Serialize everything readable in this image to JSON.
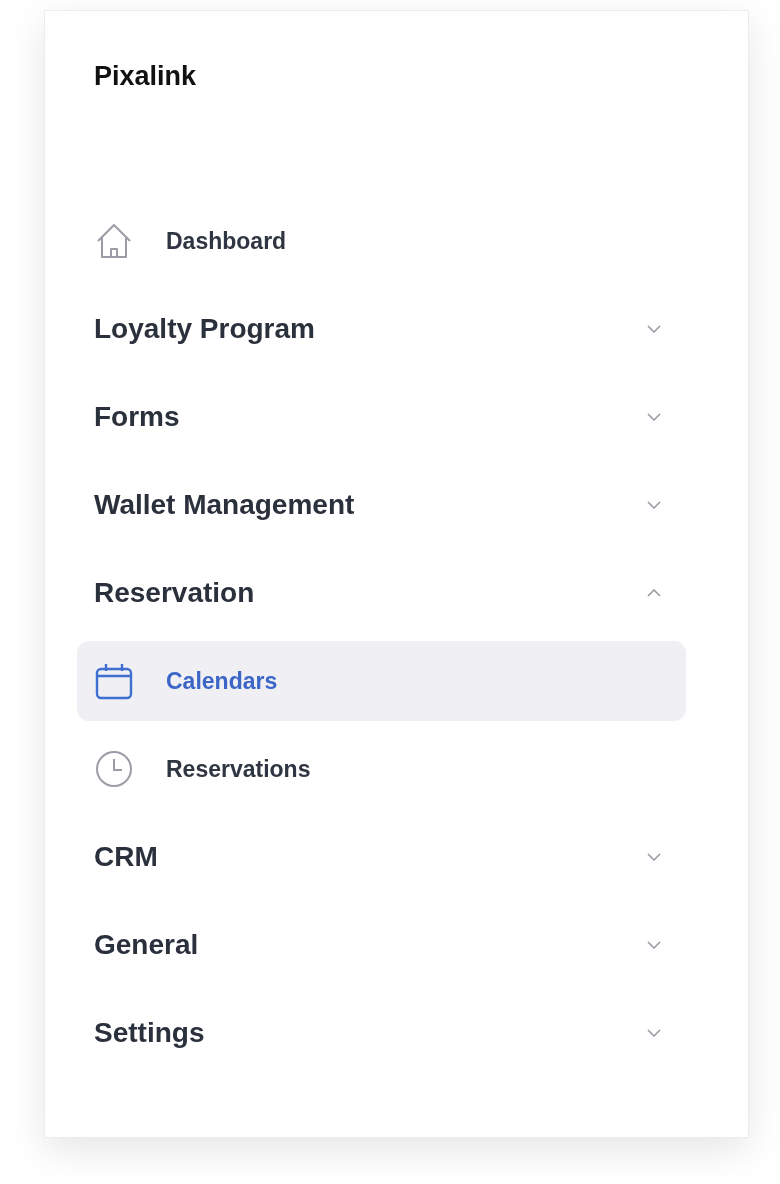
{
  "brand": "Pixalink",
  "menu": [
    {
      "kind": "link",
      "label": "Dashboard",
      "selected": false
    },
    {
      "kind": "group",
      "label": "Loyalty Program",
      "expanded": false
    },
    {
      "kind": "group",
      "label": "Forms",
      "expanded": false
    },
    {
      "kind": "group",
      "label": "Wallet Management",
      "expanded": false
    },
    {
      "kind": "group",
      "label": "Reservation",
      "expanded": true,
      "children": [
        {
          "kind": "link",
          "label": "Calendars",
          "selected": true
        },
        {
          "kind": "link",
          "label": "Reservations",
          "selected": false
        }
      ]
    },
    {
      "kind": "group",
      "label": "CRM",
      "expanded": false
    },
    {
      "kind": "group",
      "label": "General",
      "expanded": false
    },
    {
      "kind": "group",
      "label": "Settings",
      "expanded": false
    }
  ]
}
